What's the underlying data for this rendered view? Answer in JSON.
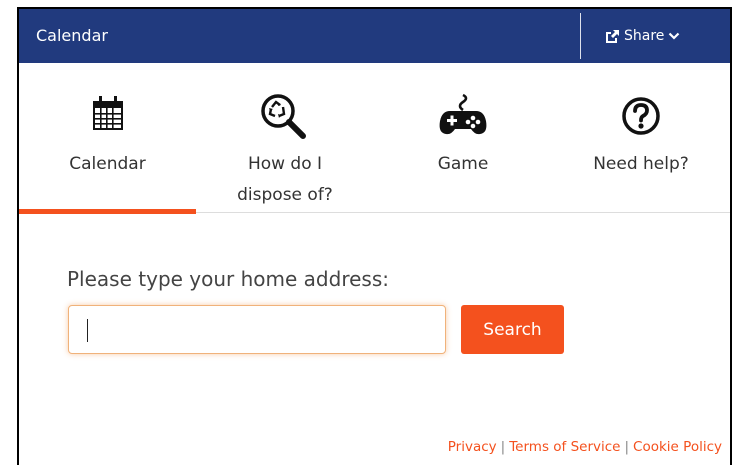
{
  "header": {
    "title": "Calendar",
    "share_label": "Share",
    "share_icon": "external-share-icon",
    "bg_color": "#213a7e"
  },
  "tabs": [
    {
      "label": "Calendar",
      "icon": "calendar-icon",
      "active": true
    },
    {
      "label_line1": "How do I",
      "label_line2": "dispose of?",
      "icon": "recycle-search-icon",
      "active": false
    },
    {
      "label": "Game",
      "icon": "gamepad-icon",
      "active": false
    },
    {
      "label": "Need help?",
      "icon": "question-circle-icon",
      "active": false
    }
  ],
  "search": {
    "prompt": "Please type your home address:",
    "input_value": "",
    "button_label": "Search"
  },
  "footer": {
    "links": [
      "Privacy",
      "Terms of Service",
      "Cookie Policy"
    ],
    "separator": "|"
  },
  "colors": {
    "accent": "#f4511e",
    "header": "#213a7e"
  }
}
